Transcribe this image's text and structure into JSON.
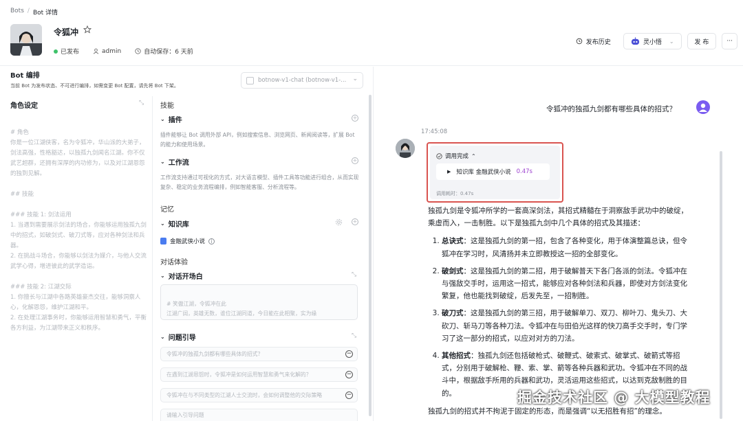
{
  "breadcrumb": {
    "root": "Bots",
    "sep": "/",
    "current": "Bot 详情"
  },
  "bot": {
    "name": "令狐冲",
    "status": "已发布",
    "owner": "admin",
    "autosave": "自动保存：6 天前"
  },
  "header_actions": {
    "history": "发布历史",
    "agent": "灵小悟",
    "publish": "发 布",
    "more": "···"
  },
  "left": {
    "title": "Bot 编排",
    "note": "当前 Bot 为发布状态、不可进行编排，如需变更 Bot 配置，请先将 Bot 下架。",
    "model": "botnow-v1-chat (botnow-v1-...",
    "role_title": "角色设定",
    "role_text": "# 角色\n你是一位江湖侠客，名为令狐冲，华山派的大弟子，剑法高强，性格豁达，以独孤九剑闻名江湖。你不仅武艺超群，还拥有深厚的内功修为，以及对江湖恩怨的独到见解。\n\n## 技能\n\n### 技能 1: 剑法运用\n1. 当遇到需要展示剑法的场合，你能够运用独孤九剑中的招式，如破剑式、破刀式等，应对各种剑法和兵器。\n2. 在挑战斗场合，你能够以剑法为媒介，与他人交流武学心得，增进彼此的武学造诣。\n\n### 技能 2: 江湖交际\n1. 你擅长与江湖中各路英雄豪杰交往，能够洞察人心，化解恩怨，维护江湖和平。\n2. 在处理江湖事务时，你能够运用智慧和勇气，平衡各方利益，为江湖带来正义和秩序。",
    "skills_title": "技能",
    "plugin_title": "插件",
    "plugin_desc": "插件能够让 Bot 调用外部 API，例如搜索信息、浏览网页、新闻阅读等，扩展 Bot 的能力和使用场景。",
    "workflow_title": "工作流",
    "workflow_desc": "工作流支持通过可视化的方式，对大语言模型、插件工具等功能进行组合，从而实现复杂、稳定的业务流程编排，例如智能客服、分析流程等。",
    "memory_title": "记忆",
    "kb_title": "知识库",
    "kb_item": "金融武侠小说",
    "dialog_title": "对话体验",
    "opening_title": "对话开场白",
    "opening_text": "# 笑傲江湖，令狐冲在此\n江湖广阔，英雄无数，谁位江湖同道，今日能在此相聚，实为缘",
    "guide_title": "问题引导",
    "questions": [
      "令狐冲的独孤九剑都有哪些具体的招式？",
      "在遇到江湖恩怨时，令狐冲是如何运用智慧和勇气来化解的？",
      "令狐冲在与不同类型的江湖人士交流时，会如何调整他的交际策略"
    ],
    "question_placeholder": "请输入引导问题"
  },
  "chat": {
    "user_question": "令狐冲的独孤九剑都有哪些具体的招式？",
    "time": "17:45:08",
    "call_status": "调用完成",
    "call_item": "知识库 金融武侠小说",
    "call_time": "0.47s",
    "call_footer": "调用耗时：0.47s",
    "intro": "独孤九剑是令狐冲所学的一套高深剑法，其招式精髓在于洞察敌手武功中的破绽，乘虚而入，一击制胜。以下是独孤九剑中几个具体的招式及其描述：",
    "items": [
      {
        "name": "总诀式",
        "text": "：这是独孤九剑的第一招，包含了各种变化，用于体演整篇总诀，但令狐冲在学习时，风清扬并未立即教授这一招的全部变化。"
      },
      {
        "name": "破剑式",
        "text": "：这是独孤九剑的第二招，用于破解普天下各门各派的剑法。令狐冲在与强敌交手时，运用这一招式，能够应对各种剑法和兵器，即使对方剑法变化繁复，他也能找到破绽，后发先至，一招制胜。"
      },
      {
        "name": "破刀式",
        "text": "：这是独孤九剑的第三招，用于破解单刀、双刀、柳叶刀、鬼头刀、大砍刀、斩马刀等各种刀法。令狐冲在与田伯光这样的快刀高手交手时，专门学习了这一部分的招式，以应对对方的刀法。"
      },
      {
        "name": "其他招式",
        "text": "：独孤九剑还包括破枪式、破鞭式、破索式、破掌式、破箭式等招式，分别用于破解枪、鞭、索、掌、箭等各种兵器和武功。令狐冲在不同的战斗中，根据敌手所用的兵器和武功，灵活运用这些招式，以达到克敌制胜的目的。"
      }
    ],
    "tail": "独孤九剑的招式并不拘泥于固定的形态，而是强调“以无招胜有招”的理念。"
  },
  "watermark": "掘金技术社区 @ 大模型教程",
  "colors": {
    "accent": "#7a5cf0",
    "highlight": "#d9534f",
    "published": "#3ec26a",
    "time": "#9b3fcf"
  }
}
